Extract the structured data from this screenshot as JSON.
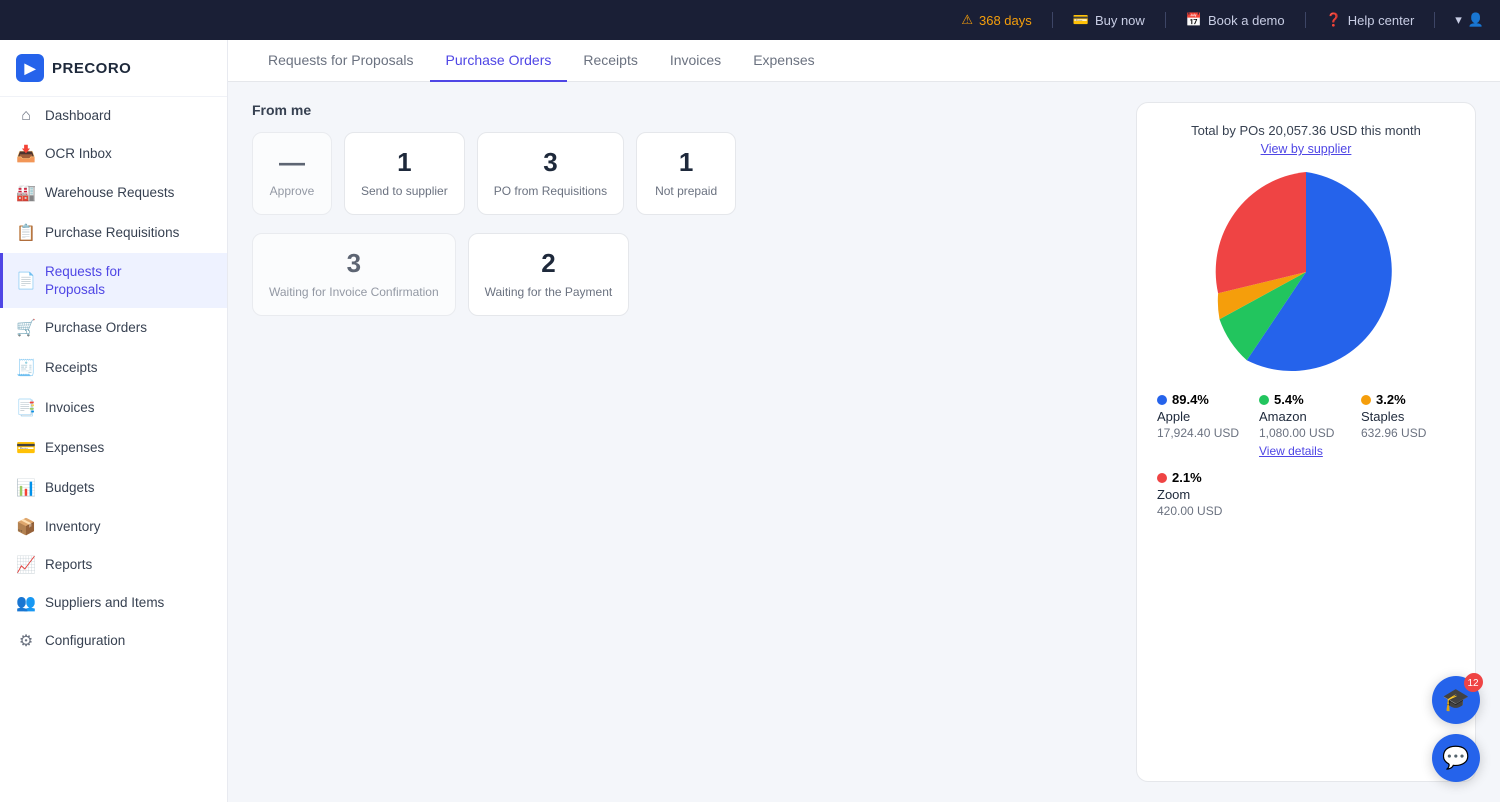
{
  "app": {
    "name": "PRECORO"
  },
  "topbar": {
    "alert_days": "368 days",
    "buy_now": "Buy now",
    "book_demo": "Book a demo",
    "help_center": "Help center"
  },
  "sidebar": {
    "items": [
      {
        "id": "dashboard",
        "label": "Dashboard",
        "icon": "home",
        "active": false,
        "has_add": false
      },
      {
        "id": "ocr-inbox",
        "label": "OCR Inbox",
        "icon": "inbox",
        "active": false,
        "has_add": false
      },
      {
        "id": "warehouse-requests",
        "label": "Warehouse Requests",
        "icon": "warehouse",
        "active": false,
        "has_add": true
      },
      {
        "id": "purchase-requisitions",
        "label": "Purchase Requisitions",
        "icon": "clipboard",
        "active": false,
        "has_add": true
      },
      {
        "id": "requests-for-proposals",
        "label": "Requests for Proposals",
        "icon": "file-text",
        "active": true,
        "has_add": true
      },
      {
        "id": "purchase-orders",
        "label": "Purchase Orders",
        "icon": "shopping-cart",
        "active": false,
        "has_add": true
      },
      {
        "id": "receipts",
        "label": "Receipts",
        "icon": "receipt",
        "active": false,
        "has_add": true
      },
      {
        "id": "invoices",
        "label": "Invoices",
        "icon": "invoice",
        "active": false,
        "has_add": true
      },
      {
        "id": "expenses",
        "label": "Expenses",
        "icon": "expenses",
        "active": false,
        "has_add": true
      },
      {
        "id": "budgets",
        "label": "Budgets",
        "icon": "budget",
        "active": false,
        "has_add": true
      },
      {
        "id": "inventory",
        "label": "Inventory",
        "icon": "box",
        "active": false,
        "has_add": false
      },
      {
        "id": "reports",
        "label": "Reports",
        "icon": "bar-chart",
        "active": false,
        "has_add": false
      },
      {
        "id": "suppliers-items",
        "label": "Suppliers and Items",
        "icon": "users",
        "active": false,
        "has_add": false
      },
      {
        "id": "configuration",
        "label": "Configuration",
        "icon": "settings",
        "active": false,
        "has_add": false
      }
    ]
  },
  "tabs": [
    {
      "id": "rfp",
      "label": "Requests for Proposals",
      "active": false
    },
    {
      "id": "po",
      "label": "Purchase Orders",
      "active": true
    },
    {
      "id": "receipts",
      "label": "Receipts",
      "active": false
    },
    {
      "id": "invoices",
      "label": "Invoices",
      "active": false
    },
    {
      "id": "expenses",
      "label": "Expenses",
      "active": false
    }
  ],
  "section_title": "From me",
  "stats_row1": [
    {
      "number": "1",
      "label": "Send to supplier"
    },
    {
      "number": "3",
      "label": "PO from Requisitions"
    },
    {
      "number": "1",
      "label": "Not prepaid"
    }
  ],
  "stats_row2": [
    {
      "number": "2",
      "label": "Waiting for the Payment"
    }
  ],
  "stats_row1_first": {
    "number": "",
    "label": "Approve"
  },
  "stats_row2_first": {
    "number": "3",
    "label": "Waiting for Invoice Confirmation"
  },
  "chart": {
    "title": "Total by POs 20,057.36 USD this month",
    "subtitle": "View by supplier",
    "suppliers": [
      {
        "name": "Apple",
        "pct": "89.4%",
        "amount": "17,924.40 USD",
        "color": "#2563eb"
      },
      {
        "name": "Amazon",
        "pct": "5.4%",
        "amount": "1,080.00 USD",
        "color": "#22c55e"
      },
      {
        "name": "Staples",
        "pct": "3.2%",
        "amount": "632.96 USD",
        "color": "#f59e0b"
      },
      {
        "name": "Zoom",
        "pct": "2.1%",
        "amount": "420.00 USD",
        "color": "#ef4444"
      }
    ],
    "view_details": "View details"
  },
  "icons": {
    "home": "⌂",
    "inbox": "📥",
    "warehouse": "🏭",
    "clipboard": "📋",
    "file-text": "📄",
    "shopping-cart": "🛒",
    "receipt": "🧾",
    "invoice": "📑",
    "expenses": "💳",
    "budget": "📊",
    "box": "📦",
    "bar-chart": "📈",
    "users": "👥",
    "settings": "⚙️"
  }
}
